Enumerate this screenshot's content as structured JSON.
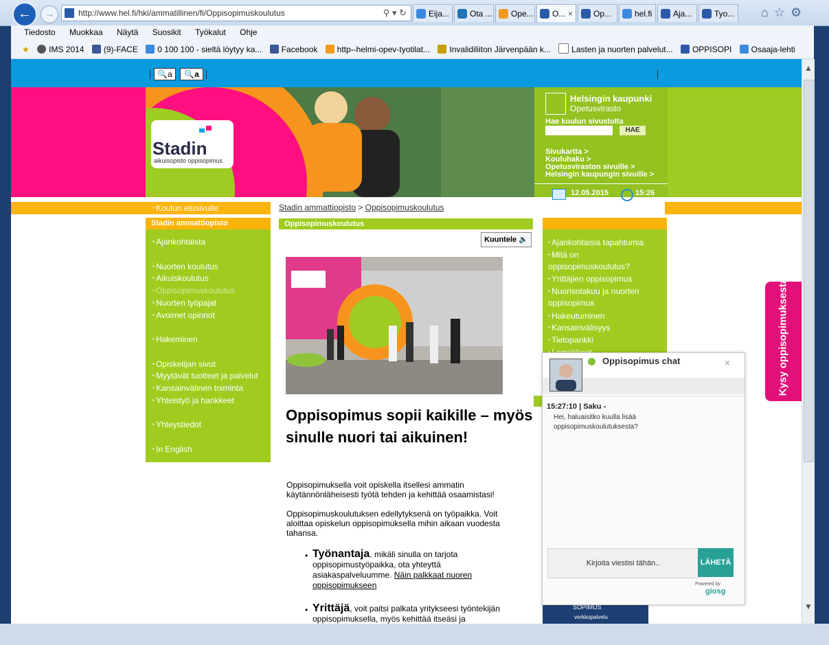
{
  "browser": {
    "address": "http://www.hel.fi/hki/ammatillinen/fi/Oppisopimuskoulutus",
    "address_domain": "hel.fi",
    "tabs": [
      {
        "label": "Eija..."
      },
      {
        "label": "Ota ..."
      },
      {
        "label": "Ope..."
      },
      {
        "label": "O..."
      },
      {
        "label": "Op..."
      },
      {
        "label": "hel.fi"
      },
      {
        "label": "Aja..."
      },
      {
        "label": "Tyo..."
      }
    ],
    "menu": [
      "Tiedosto",
      "Muokkaa",
      "Näytä",
      "Suosikit",
      "Työkalut",
      "Ohje"
    ],
    "favorites": [
      {
        "label": "IMS 2014"
      },
      {
        "label": "(9)-FACE"
      },
      {
        "label": "0 100 100 - sieltä löytyy ka..."
      },
      {
        "label": "Facebook"
      },
      {
        "label": "http--helmi-opev-tyotilat..."
      },
      {
        "label": "Invalidiliiton Järvenpään k..."
      },
      {
        "label": "Lasten ja nuorten palvelut..."
      },
      {
        "label": "OPPISOPI"
      },
      {
        "label": "Osaaja-lehti"
      }
    ]
  },
  "page": {
    "zoom_out": "a",
    "zoom_in": "a",
    "logo_name": "Stadin",
    "logo_sub": "aikuisopisto oppisopimus",
    "city_name": "Helsingin kaupunki",
    "city_dept": "Opetusvirasto",
    "search_label": "Hae koulun sivustolta",
    "search_button": "HAE",
    "header_links": [
      "Sivukartta >",
      "Kouluhaku >",
      "Opetusviraston sivuille >",
      "Helsingin kaupungin sivuille >"
    ],
    "date": "12.05.2015",
    "time": "15:26",
    "home_link": "Koulun etusivulle",
    "breadcrumb": {
      "root": "Stadin ammattiopisto",
      "sep": ">",
      "current": "Oppisopimuskoulutus"
    },
    "left_nav_title": "Stadin ammattiopisto",
    "left_nav": [
      {
        "label": "Ajankohtaista"
      },
      {
        "label": "Nuorten koulutus"
      },
      {
        "label": "Aikuiskoulutus"
      },
      {
        "label": "Oppisopimuskoulutus"
      },
      {
        "label": "Nuorten työpajat"
      },
      {
        "label": "Avoimet opinnot"
      },
      {
        "label": "Hakeminen"
      },
      {
        "label": "Opiskelijan sivut"
      },
      {
        "label": "Myytävät tuotteet ja palvelut"
      },
      {
        "label": "Kansainvälinen toiminta"
      },
      {
        "label": "Yhteistyö ja hankkeet"
      },
      {
        "label": "Yhteystiedot"
      },
      {
        "label": "In English"
      }
    ],
    "section_title": "Oppisopimuskoulutus",
    "listen_button": "Kuuntele",
    "headline": "Oppisopimus sopii kaikille – myös sinulle nuori tai aikuinen!",
    "para1": "Oppisopimuksella voit opiskella itsellesi ammatin käytännönläheisesti työtä tehden ja kehittää osaamistasi!",
    "para2": "Oppisopimuskoulutuksen edellytyksenä on työpaikka. Voit aloittaa opiskelun oppisopimuksella mihin aikaan vuodesta tahansa.",
    "bullet1_title": "Työnantaja",
    "bullet1_text": ", mikäli sinulla on tarjota oppisopimustyöpaikka, ota yhteyttä asiakaspalveluumme.",
    "bullet1_link": "Näin palkkaat nuoren oppisopimukseen",
    "bullet2_title": "Yrittäjä",
    "bullet2_text": ", voit paitsi palkata yritykseesi työntekijän oppisopimuksella, myös kehittää itseäsi ja",
    "right_nav": [
      {
        "label": "Ajankohtaisia tapahtumia"
      },
      {
        "label": "Mitä on oppisopimuskoulutus?"
      },
      {
        "label": "Yrittäjien oppisopimus"
      },
      {
        "label": "Nuorisotakuu ja nuorten oppisopimus"
      },
      {
        "label": "Hakeutuminen"
      },
      {
        "label": "Kansainvälisyys"
      },
      {
        "label": "Tietopankki"
      },
      {
        "label": "Lomakkeet"
      }
    ],
    "right_bottom_title": "SOPIMUS",
    "right_bottom_sub": "verkkopalvelu",
    "side_tab": "Kysy oppisopimuksesta"
  },
  "chat": {
    "title": "Oppisopimus chat",
    "close": "×",
    "msg_header": "15:27:10 | Saku -",
    "msg_text": "Hei, haluaisitko kuulla lisää oppisopimuskoulutuksesta?",
    "input_placeholder": "Kirjoita viestisi tähän..",
    "send": "LÄHETÄ",
    "powered": "Powered by",
    "brand": "giosg"
  }
}
